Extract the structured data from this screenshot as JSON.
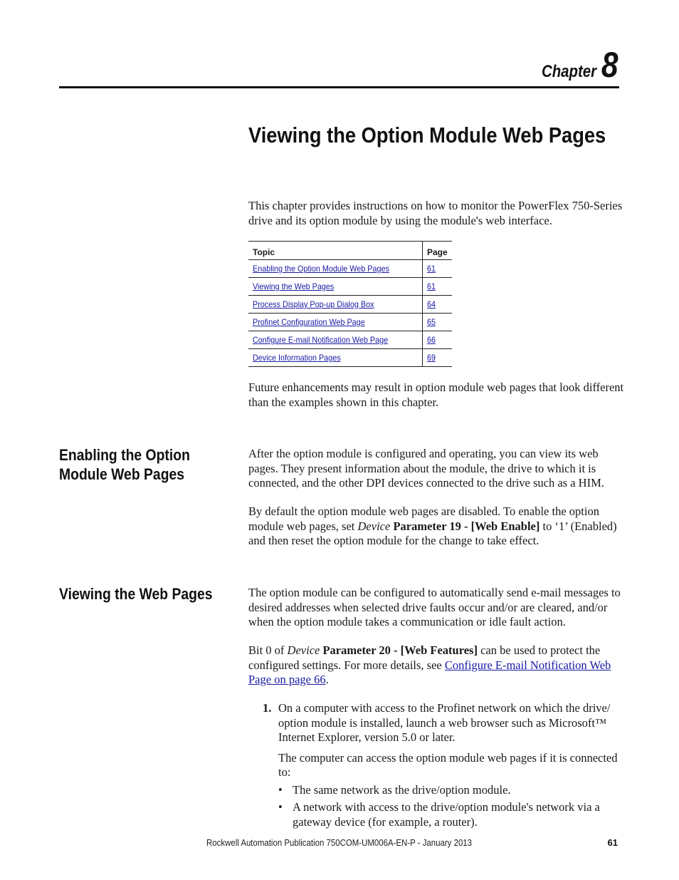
{
  "header": {
    "chapter_word": "Chapter",
    "chapter_number": "8"
  },
  "title": "Viewing the Option Module Web Pages",
  "intro": "This chapter provides instructions on how to monitor the PowerFlex 750-Series drive and its option module by using the module's web interface.",
  "toc": {
    "headers": {
      "topic": "Topic",
      "page": "Page"
    },
    "rows": [
      {
        "topic": "Enabling the Option Module Web Pages",
        "page": "61"
      },
      {
        "topic": "Viewing the Web Pages",
        "page": "61"
      },
      {
        "topic": "Process Display Pop-up Dialog Box",
        "page": "64"
      },
      {
        "topic": "Profinet Configuration Web Page",
        "page": "65"
      },
      {
        "topic": "Configure E-mail Notification Web Page",
        "page": "66"
      },
      {
        "topic": "Device Information Pages",
        "page": "69"
      }
    ]
  },
  "future_note": "Future enhancements may result in option module web pages that look different than the examples shown in this chapter.",
  "section_enabling": {
    "heading": "Enabling the Option Module Web Pages",
    "para1": "After the option module is configured and operating, you can view its web pages. They present information about the module, the drive to which it is connected, and the other DPI devices connected to the drive such as a HIM.",
    "para2_pre": "By default the option module web pages are disabled. To enable the option module web pages, set ",
    "para2_device": "Device",
    "para2_param": "Parameter 19 - [",
    "para2_param_name": "Web Enable",
    "para2_param_close": "]",
    "para2_post": " to ‘1’ (Enabled) and then reset the option module for the change to take effect."
  },
  "section_viewing": {
    "heading": "Viewing the Web Pages",
    "para1": "The option module can be configured to automatically send e-mail messages to desired addresses when selected drive faults occur and/or  are cleared, and/or when the option module takes a communication or idle fault action.",
    "para2_pre": "Bit 0 of ",
    "para2_device": "Device",
    "para2_param": " Parameter 20 - [",
    "para2_param_name": "Web Features",
    "para2_param_close": "]",
    "para2_mid": " can be used to protect the configured settings. For more details, see ",
    "para2_link": "Configure E-mail Notification Web Page on page 66",
    "para2_end": ".",
    "steps": [
      {
        "number": "1.",
        "text": "On a computer with access to the Profinet network on which the drive/ option module is installed, launch a web browser such as Microsoft™ Internet Explorer, version 5.0 or later.",
        "note": "The computer can access the option module web pages if it is connected to:",
        "bullets": [
          "The same network as the drive/option module.",
          "A network with access to the drive/option module's network via a gateway device (for example, a router)."
        ]
      }
    ]
  },
  "footer": {
    "publication": "Rockwell Automation Publication 750COM-UM006A-EN-P - January 2013",
    "page_number": "61"
  },
  "colors": {
    "link": "#1a1aa6",
    "text": "#1a1a1a"
  }
}
